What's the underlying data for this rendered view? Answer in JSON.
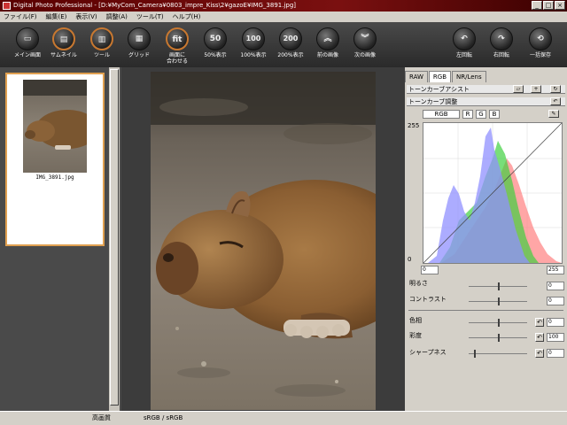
{
  "window": {
    "title": "Digital Photo Professional - [D:¥MyCom_Camera¥0803_impre_Kiss\\2¥gazoE¥IMG_3891.jpg]",
    "minimize": "_",
    "maximize": "□",
    "close": "×"
  },
  "menu": [
    "ファイル(F)",
    "編集(E)",
    "表示(V)",
    "調整(A)",
    "ツール(T)",
    "ヘルプ(H)"
  ],
  "toolbar": {
    "main": "メイン画面",
    "thumbnail": "サムネイル",
    "tool": "ツール",
    "grid": "グリッド",
    "fit_line1": "画面に",
    "fit_line2": "合わせる",
    "zoom50": "50%表示",
    "zoom100": "100%表示",
    "zoom200": "200%表示",
    "zoom50_icon": "50",
    "zoom100_icon": "100",
    "zoom200_icon": "200",
    "prev": "前の画像",
    "next": "次の画像",
    "rotate_left": "左回転",
    "rotate_right": "右回転",
    "batch_save": "一括保存"
  },
  "thumbnail": {
    "filename": "IMG_3891.jpg"
  },
  "right": {
    "tabs": [
      "RAW",
      "RGB",
      "NR/Lens"
    ],
    "active_tab": "RGB",
    "tone_assist": "トーンカーブアシスト",
    "tone_adjust": "トーンカーブ調整",
    "channels": [
      "RGB",
      "R",
      "G",
      "B"
    ],
    "axis_top": "255",
    "axis_bottom": "0",
    "in_min": "0",
    "in_max": "255",
    "brightness_label": "明るさ",
    "brightness_value": "0",
    "contrast_label": "コントラスト",
    "contrast_value": "0",
    "hue_label": "色相",
    "hue_value": "0",
    "saturation_label": "彩度",
    "saturation_value": "100",
    "sharpness_label": "シャープネス",
    "sharpness_value": "0"
  },
  "status": {
    "quality": "高画質",
    "colorspace": "sRGB / sRGB"
  },
  "colors": {
    "toolbar_bg": "#333333",
    "panel_bg": "#d4d0c8",
    "accent_orange": "#c87830",
    "hist_blue": "#8080ff",
    "hist_green": "#30c030",
    "hist_red": "#ff8080"
  }
}
